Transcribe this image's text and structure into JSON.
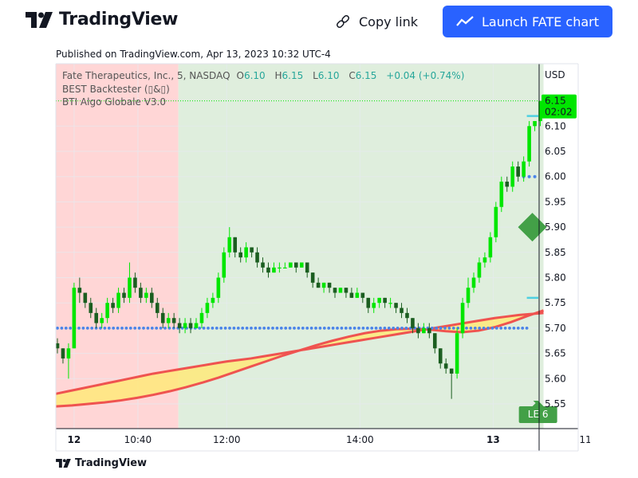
{
  "header": {
    "brand": "TradingView",
    "copy_link_label": "Copy link",
    "launch_label": "Launch FATE chart"
  },
  "published": "Published on TradingView.com, Apr 13, 2023 10:32 UTC-4",
  "footer_brand": "TradingView",
  "colors": {
    "accent": "#2962ff",
    "up": "#00e600",
    "down": "#1b5e20",
    "ema": "#ef5350",
    "fill": "#ffe97a",
    "bg_red": "#ffd6d6",
    "bg_green": "#dfeedd",
    "dot_line": "#4a84e8",
    "cyan": "#4dd0e1"
  },
  "chart_data": {
    "type": "candlestick",
    "symbol": "FATE",
    "legend": {
      "title": "Fate Therapeutics, Inc., 5, NASDAQ",
      "o_label": "O",
      "o": "6.10",
      "h_label": "H",
      "h": "6.15",
      "l_label": "L",
      "l": "6.10",
      "c_label": "C",
      "c": "6.15",
      "change": "+0.04 (+0.74%)",
      "indicator1": "BEST Backtester (▯&▯)",
      "indicator2": "BTI Algo Globale V3.0"
    },
    "currency": "USD",
    "ylim": [
      5.5,
      6.2
    ],
    "y_ticks": [
      5.55,
      5.6,
      5.65,
      5.7,
      5.75,
      5.8,
      5.85,
      5.9,
      5.95,
      6.0,
      6.05,
      6.1
    ],
    "y_tick_labels": [
      "5.55",
      "5.60",
      "5.65",
      "5.70",
      "5.75",
      "5.80",
      "5.85",
      "5.90",
      "5.95",
      "6.00",
      "6.05",
      "6.10"
    ],
    "x_labels": [
      {
        "label": "12",
        "bold": true,
        "bar": 3
      },
      {
        "label": "10:40",
        "bold": false,
        "bar": 14.5
      },
      {
        "label": "12:00",
        "bold": false,
        "bar": 30.5
      },
      {
        "label": "14:00",
        "bold": false,
        "bar": 54.5
      },
      {
        "label": "13",
        "bold": true,
        "bar": 78.5
      },
      {
        "label": "11:00",
        "bold": false,
        "bar": 96.5
      }
    ],
    "last_price": {
      "value": "6.15",
      "countdown": "02:02"
    },
    "signal_label": "LE 6",
    "red_zone_bars": 22,
    "long_stop_level": 5.7,
    "target_levels": [
      6.12,
      5.76
    ],
    "entry_marker": 5.9,
    "upper_dots_level": 6.0,
    "ema_top": [
      5.57,
      5.575,
      5.58,
      5.585,
      5.59,
      5.595,
      5.6,
      5.605,
      5.61,
      5.614,
      5.618,
      5.622,
      5.626,
      5.63,
      5.634,
      5.637,
      5.64,
      5.644,
      5.648,
      5.652,
      5.656,
      5.66,
      5.664,
      5.668,
      5.672,
      5.676,
      5.68,
      5.684,
      5.688,
      5.692,
      5.696,
      5.7,
      5.704,
      5.708,
      5.712,
      5.716,
      5.72,
      5.723,
      5.726,
      5.728,
      5.73
    ],
    "ema_bottom": [
      5.545,
      5.547,
      5.55,
      5.553,
      5.557,
      5.562,
      5.568,
      5.575,
      5.583,
      5.592,
      5.602,
      5.613,
      5.624,
      5.635,
      5.646,
      5.656,
      5.666,
      5.675,
      5.683,
      5.69,
      5.695,
      5.698,
      5.699,
      5.697,
      5.694,
      5.692,
      5.695,
      5.702,
      5.712,
      5.724,
      5.735
    ],
    "candles": [
      [
        5.67,
        5.66,
        5.68,
        5.65
      ],
      [
        5.66,
        5.64,
        5.66,
        5.63
      ],
      [
        5.64,
        5.66,
        5.67,
        5.6
      ],
      [
        5.66,
        5.78,
        5.79,
        5.66
      ],
      [
        5.78,
        5.77,
        5.8,
        5.75
      ],
      [
        5.77,
        5.75,
        5.77,
        5.74
      ],
      [
        5.75,
        5.73,
        5.76,
        5.72
      ],
      [
        5.73,
        5.71,
        5.74,
        5.7
      ],
      [
        5.71,
        5.72,
        5.73,
        5.7
      ],
      [
        5.72,
        5.75,
        5.76,
        5.71
      ],
      [
        5.75,
        5.74,
        5.76,
        5.73
      ],
      [
        5.74,
        5.77,
        5.78,
        5.73
      ],
      [
        5.77,
        5.76,
        5.78,
        5.75
      ],
      [
        5.76,
        5.8,
        5.83,
        5.75
      ],
      [
        5.8,
        5.78,
        5.81,
        5.77
      ],
      [
        5.78,
        5.76,
        5.79,
        5.75
      ],
      [
        5.76,
        5.77,
        5.78,
        5.75
      ],
      [
        5.77,
        5.75,
        5.78,
        5.74
      ],
      [
        5.75,
        5.73,
        5.76,
        5.72
      ],
      [
        5.73,
        5.71,
        5.74,
        5.7
      ],
      [
        5.71,
        5.72,
        5.73,
        5.7
      ],
      [
        5.72,
        5.71,
        5.73,
        5.7
      ],
      [
        5.71,
        5.7,
        5.72,
        5.69
      ],
      [
        5.7,
        5.71,
        5.72,
        5.69
      ],
      [
        5.71,
        5.7,
        5.72,
        5.69
      ],
      [
        5.7,
        5.71,
        5.72,
        5.7
      ],
      [
        5.71,
        5.73,
        5.74,
        5.7
      ],
      [
        5.73,
        5.75,
        5.76,
        5.72
      ],
      [
        5.75,
        5.76,
        5.77,
        5.74
      ],
      [
        5.76,
        5.8,
        5.81,
        5.75
      ],
      [
        5.8,
        5.85,
        5.86,
        5.79
      ],
      [
        5.85,
        5.88,
        5.9,
        5.84
      ],
      [
        5.88,
        5.85,
        5.88,
        5.84
      ],
      [
        5.85,
        5.84,
        5.86,
        5.83
      ],
      [
        5.84,
        5.86,
        5.87,
        5.83
      ],
      [
        5.86,
        5.85,
        5.86,
        5.84
      ],
      [
        5.85,
        5.83,
        5.86,
        5.82
      ],
      [
        5.83,
        5.82,
        5.84,
        5.81
      ],
      [
        5.82,
        5.81,
        5.83,
        5.8
      ],
      [
        5.81,
        5.82,
        5.83,
        5.81
      ],
      [
        5.82,
        5.82,
        5.83,
        5.81
      ],
      [
        5.82,
        5.82,
        5.83,
        5.82
      ],
      [
        5.82,
        5.83,
        5.83,
        5.82
      ],
      [
        5.83,
        5.82,
        5.83,
        5.81
      ],
      [
        5.82,
        5.83,
        5.83,
        5.82
      ],
      [
        5.83,
        5.81,
        5.83,
        5.8
      ],
      [
        5.81,
        5.79,
        5.81,
        5.78
      ],
      [
        5.79,
        5.78,
        5.8,
        5.78
      ],
      [
        5.78,
        5.79,
        5.79,
        5.77
      ],
      [
        5.79,
        5.78,
        5.79,
        5.77
      ],
      [
        5.78,
        5.77,
        5.78,
        5.76
      ],
      [
        5.77,
        5.78,
        5.78,
        5.77
      ],
      [
        5.78,
        5.77,
        5.78,
        5.76
      ],
      [
        5.77,
        5.76,
        5.78,
        5.76
      ],
      [
        5.76,
        5.77,
        5.78,
        5.76
      ],
      [
        5.77,
        5.76,
        5.77,
        5.75
      ],
      [
        5.76,
        5.74,
        5.76,
        5.73
      ],
      [
        5.74,
        5.75,
        5.76,
        5.73
      ],
      [
        5.75,
        5.76,
        5.76,
        5.74
      ],
      [
        5.76,
        5.75,
        5.76,
        5.74
      ],
      [
        5.75,
        5.75,
        5.76,
        5.74
      ],
      [
        5.75,
        5.74,
        5.75,
        5.73
      ],
      [
        5.74,
        5.73,
        5.75,
        5.72
      ],
      [
        5.73,
        5.72,
        5.74,
        5.71
      ],
      [
        5.72,
        5.7,
        5.72,
        5.69
      ],
      [
        5.7,
        5.69,
        5.71,
        5.68
      ],
      [
        5.69,
        5.7,
        5.71,
        5.69
      ],
      [
        5.7,
        5.69,
        5.71,
        5.68
      ],
      [
        5.69,
        5.66,
        5.69,
        5.65
      ],
      [
        5.66,
        5.63,
        5.66,
        5.62
      ],
      [
        5.63,
        5.62,
        5.64,
        5.61
      ],
      [
        5.62,
        5.61,
        5.62,
        5.56
      ],
      [
        5.61,
        5.69,
        5.7,
        5.6
      ],
      [
        5.69,
        5.75,
        5.76,
        5.68
      ],
      [
        5.75,
        5.78,
        5.8,
        5.74
      ],
      [
        5.78,
        5.8,
        5.81,
        5.77
      ],
      [
        5.8,
        5.83,
        5.84,
        5.79
      ],
      [
        5.83,
        5.84,
        5.85,
        5.82
      ],
      [
        5.84,
        5.88,
        5.89,
        5.83
      ],
      [
        5.88,
        5.94,
        5.95,
        5.87
      ],
      [
        5.94,
        5.99,
        6.0,
        5.93
      ],
      [
        5.99,
        5.98,
        6.0,
        5.97
      ],
      [
        5.98,
        6.02,
        6.03,
        5.97
      ],
      [
        6.02,
        6.0,
        6.03,
        5.99
      ],
      [
        6.0,
        6.03,
        6.04,
        5.99
      ],
      [
        6.03,
        6.1,
        6.11,
        6.02
      ],
      [
        6.1,
        6.11,
        6.11,
        6.09
      ],
      [
        6.11,
        6.15,
        6.15,
        6.1
      ]
    ]
  }
}
